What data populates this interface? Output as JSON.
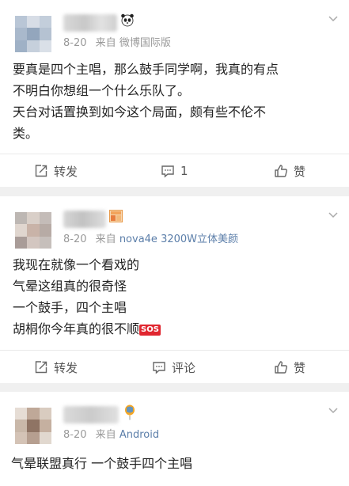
{
  "posts": [
    {
      "date": "8-20",
      "source_prefix": "来自",
      "source": "微博国际版",
      "content": [
        "要真是四个主唱，那么鼓手同学啊，我真的有点",
        "不明白你想组一个什么乐队了。",
        "天台对话置换到如今这个局面，颇有些不伦不",
        "类。"
      ],
      "actions": {
        "repost": "转发",
        "comment": "1",
        "like": "赞"
      }
    },
    {
      "date": "8-20",
      "source_prefix": "来自",
      "source": "nova4e 3200W立体美颜",
      "content": [
        "我现在就像一个看戏的",
        "气晕这组真的很奇怪",
        "一个鼓手，四个主唱",
        "胡桐你今年真的很不顺"
      ],
      "sos_label": "SOS",
      "actions": {
        "repost": "转发",
        "comment": "评论",
        "like": "赞"
      }
    },
    {
      "date": "8-20",
      "source_prefix": "来自",
      "source": "Android",
      "content": [
        "气晕联盟真行 一个鼓手四个主唱"
      ]
    }
  ],
  "icons": {
    "badges": [
      "panda-icon",
      "flag-icon",
      "balloon-icon"
    ],
    "menu": "chevron-down-icon",
    "repost": "repost-icon",
    "comment": "comment-icon",
    "like": "thumbs-up-icon"
  },
  "colors": {
    "link": "#5b7ea9",
    "meta": "#999999",
    "text": "#222222",
    "separator": "#f0f0f0",
    "sos": "#e0262f"
  }
}
